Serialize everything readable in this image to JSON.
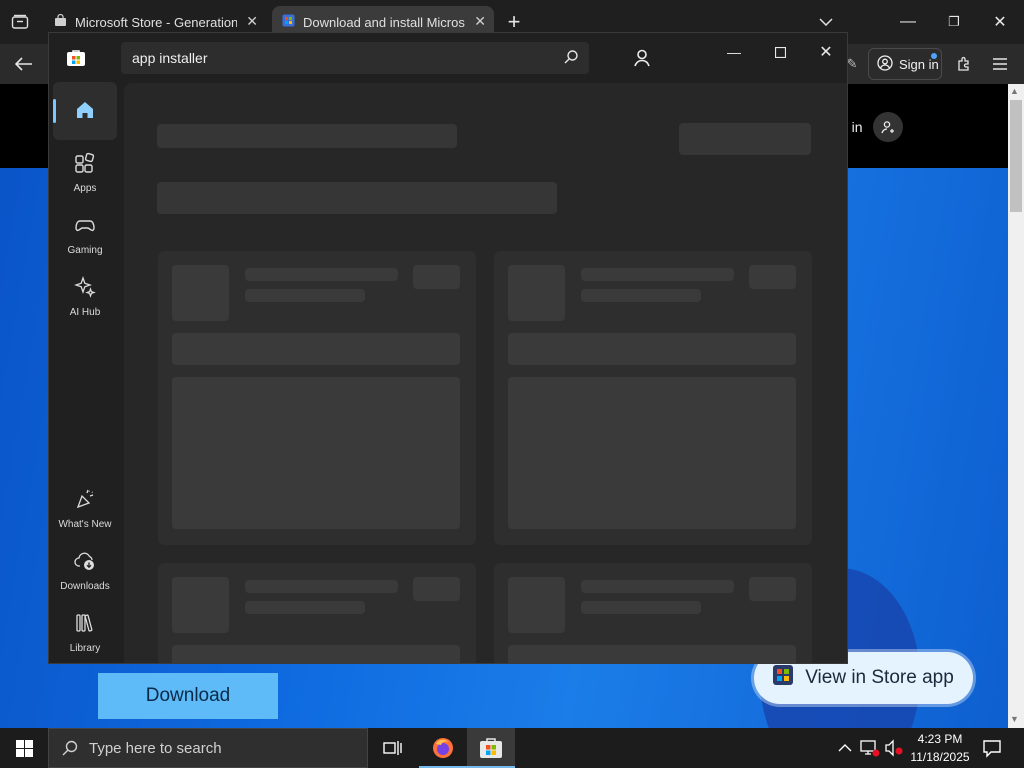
{
  "browser": {
    "tabs": [
      {
        "title": "Microsoft Store - Generation Pr"
      },
      {
        "title": "Download and install Microsoft"
      }
    ],
    "signin_label": "Sign in"
  },
  "webpage": {
    "signin_label": "n in",
    "download_label": "Download",
    "view_store_label": "View in Store app"
  },
  "store": {
    "search_value": "app installer",
    "nav": {
      "apps": "Apps",
      "gaming": "Gaming",
      "ai_hub": "AI Hub",
      "whats_new": "What's New",
      "downloads": "Downloads",
      "library": "Library"
    }
  },
  "taskbar": {
    "search_placeholder": "Type here to search",
    "time": "4:23 PM",
    "date": "11/18/2025"
  },
  "colors": {
    "accent": "#5ebbf7",
    "page_blue": "#0f6be0",
    "store_bg": "#202020"
  }
}
